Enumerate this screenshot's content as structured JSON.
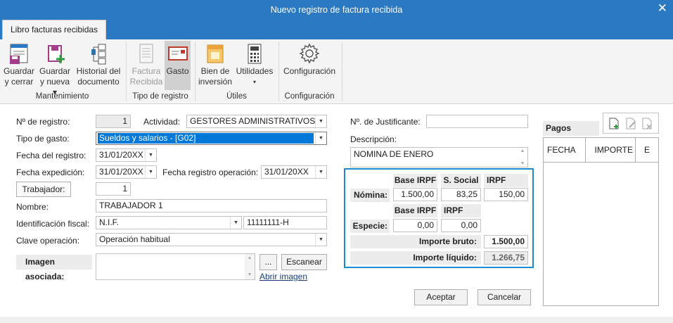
{
  "window": {
    "title": "Nuevo registro de factura recibida",
    "close_glyph": "✕"
  },
  "tab": {
    "label": "Libro facturas recibidas"
  },
  "ribbon": {
    "groups": [
      {
        "name": "Mantenimiento",
        "buttons": [
          {
            "line1": "Guardar",
            "line2": "y cerrar",
            "icon": "save-close-icon"
          },
          {
            "line1": "Guardar",
            "line2": "y nueva ▾",
            "icon": "save-new-icon"
          },
          {
            "line1": "Historial del",
            "line2": "documento",
            "icon": "history-icon"
          }
        ]
      },
      {
        "name": "Tipo de registro",
        "buttons": [
          {
            "line1": "Factura",
            "line2": "Recibida",
            "icon": "invoice-icon",
            "disabled": true
          },
          {
            "line1": "Gasto",
            "line2": "",
            "icon": "expense-icon",
            "selected": true
          }
        ]
      },
      {
        "name": "Útiles",
        "buttons": [
          {
            "line1": "Bien de",
            "line2": "inversión",
            "icon": "asset-icon"
          },
          {
            "line1": "Utilidades",
            "line2": "▾",
            "icon": "calculator-icon"
          }
        ]
      },
      {
        "name": "Configuración",
        "buttons": [
          {
            "line1": "Configuración",
            "line2": "",
            "icon": "gear-icon"
          }
        ]
      }
    ]
  },
  "form": {
    "registro": {
      "label": "Nº de registro:",
      "value": "1"
    },
    "actividad": {
      "label": "Actividad:",
      "value": "GESTORES ADMINISTRATIVOS"
    },
    "tipo_gasto": {
      "label": "Tipo de gasto:",
      "value": "Sueldos y salarios - [G02]"
    },
    "fecha_registro": {
      "label": "Fecha del registro:",
      "value": "31/01/20XX"
    },
    "fecha_expedicion": {
      "label": "Fecha expedición:",
      "value": "31/01/20XX"
    },
    "fecha_reg_operacion": {
      "label": "Fecha registro operación:",
      "value": "31/01/20XX"
    },
    "trabajador": {
      "button": "Trabajador:",
      "value": "1"
    },
    "nombre": {
      "label": "Nombre:",
      "value": "TRABAJADOR 1"
    },
    "identificacion": {
      "label": "Identificación fiscal:",
      "type": "N.I.F.",
      "value": "11111111-H"
    },
    "clave": {
      "label": "Clave operación:",
      "value": "Operación habitual"
    },
    "imagen": {
      "label": "Imagen asociada:",
      "browse": "...",
      "scan": "Escanear",
      "link": "Abrir imagen"
    },
    "justificante": {
      "label": "Nº. de Justificante:",
      "value": ""
    },
    "descripcion": {
      "label": "Descripción:",
      "value": "NOMINA DE ENERO"
    }
  },
  "nomina": {
    "headers": [
      "Base IRPF",
      "S. Social",
      "IRPF"
    ],
    "label": "Nómina:",
    "values": [
      "1.500,00",
      "83,25",
      "150,00"
    ]
  },
  "especie": {
    "headers": [
      "Base IRPF",
      "IRPF"
    ],
    "label": "Especie:",
    "values": [
      "0,00",
      "0,00"
    ]
  },
  "importe_bruto": {
    "label": "Importe bruto:",
    "value": "1.500,00"
  },
  "importe_liquido": {
    "label": "Importe líquido:",
    "value": "1.266,75"
  },
  "pagos": {
    "title": "Pagos",
    "columns": [
      "FECHA",
      "IMPORTE",
      "E"
    ]
  },
  "actions": {
    "accept": "Aceptar",
    "cancel": "Cancelar"
  },
  "colors": {
    "title_bar": "#2b79c2",
    "highlight": "#0078d7",
    "panel_border": "#1f8ad0"
  }
}
